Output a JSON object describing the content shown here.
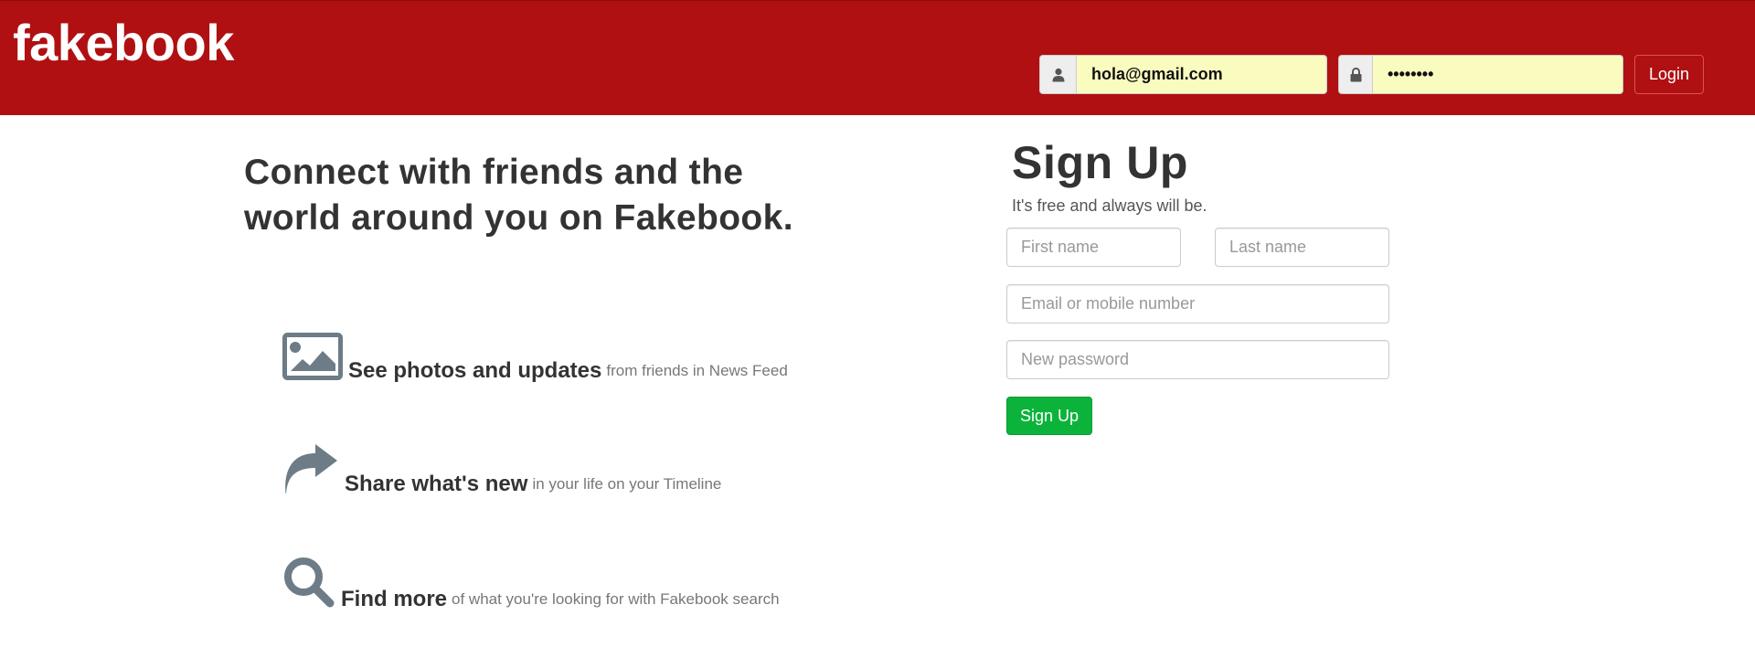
{
  "header": {
    "logo_text": "fakebook",
    "background_color": "#b01012",
    "login": {
      "email_icon": "user-icon",
      "email_value": "hola@gmail.com",
      "password_icon": "lock-icon",
      "password_value": "••••••••",
      "button_label": "Login"
    }
  },
  "intro": {
    "headline": "Connect with friends and the world around you on Fakebook.",
    "features": [
      {
        "icon": "image-icon",
        "title": "See photos and updates",
        "description": "from friends in News Feed"
      },
      {
        "icon": "share-arrow-icon",
        "title": "Share what's new",
        "description": "in your life on your Timeline"
      },
      {
        "icon": "search-icon",
        "title": "Find more",
        "description": "of what you're looking for with Fakebook search"
      }
    ]
  },
  "signup": {
    "title": "Sign Up",
    "subtitle": "It's free and always will be.",
    "first_name_placeholder": "First name",
    "last_name_placeholder": "Last name",
    "email_placeholder": "Email or mobile number",
    "password_placeholder": "New password",
    "button_label": "Sign Up",
    "button_color": "#0cb33b"
  }
}
